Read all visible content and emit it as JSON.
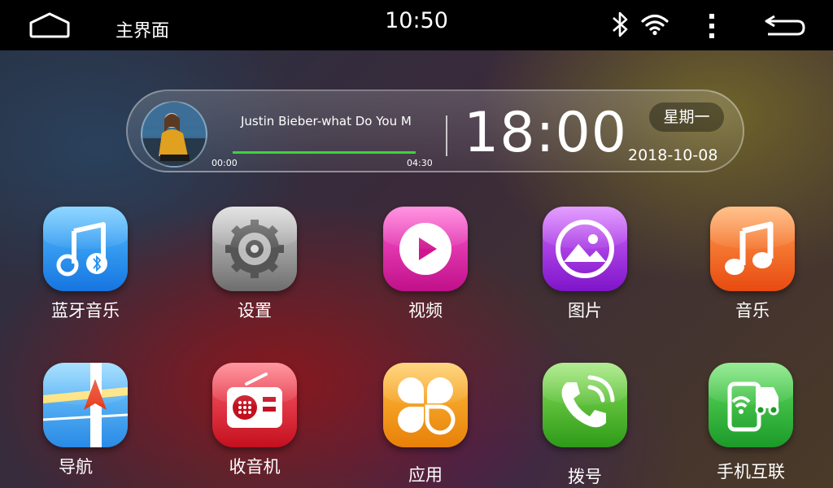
{
  "status_bar": {
    "title": "主界面",
    "time": "10:50",
    "icons": [
      "home-icon",
      "bluetooth-icon",
      "wifi-icon",
      "more-vert-icon",
      "back-icon"
    ]
  },
  "media": {
    "song": "Justin Bieber-what Do You M",
    "elapsed": "00:00",
    "duration": "04:30",
    "progress": 1.0,
    "progress_color": "#3fd23f"
  },
  "clock": {
    "time": "18:00",
    "weekday": "星期一",
    "date": "2018-10-08"
  },
  "apps": [
    {
      "label": "蓝牙音乐",
      "icon": "bluetooth-music-icon",
      "color": "#1e8ff0"
    },
    {
      "label": "设置",
      "icon": "settings-gear-icon",
      "color": "#8a8a8a"
    },
    {
      "label": "视频",
      "icon": "video-play-icon",
      "color": "#e01aa0"
    },
    {
      "label": "图片",
      "icon": "picture-icon",
      "color": "#9a28d8"
    },
    {
      "label": "音乐",
      "icon": "music-note-icon",
      "color": "#f2641a"
    },
    {
      "label": "导航",
      "icon": "navigation-map-icon",
      "color": "#2d9ae8"
    },
    {
      "label": "收音机",
      "icon": "radio-icon",
      "color": "#e0182c"
    },
    {
      "label": "应用",
      "icon": "apps-icon",
      "color": "#f09a12"
    },
    {
      "label": "拨号",
      "icon": "phone-dial-icon",
      "color": "#4cb82a"
    },
    {
      "label": "手机互联",
      "icon": "phone-link-icon",
      "color": "#2aa83a"
    }
  ]
}
